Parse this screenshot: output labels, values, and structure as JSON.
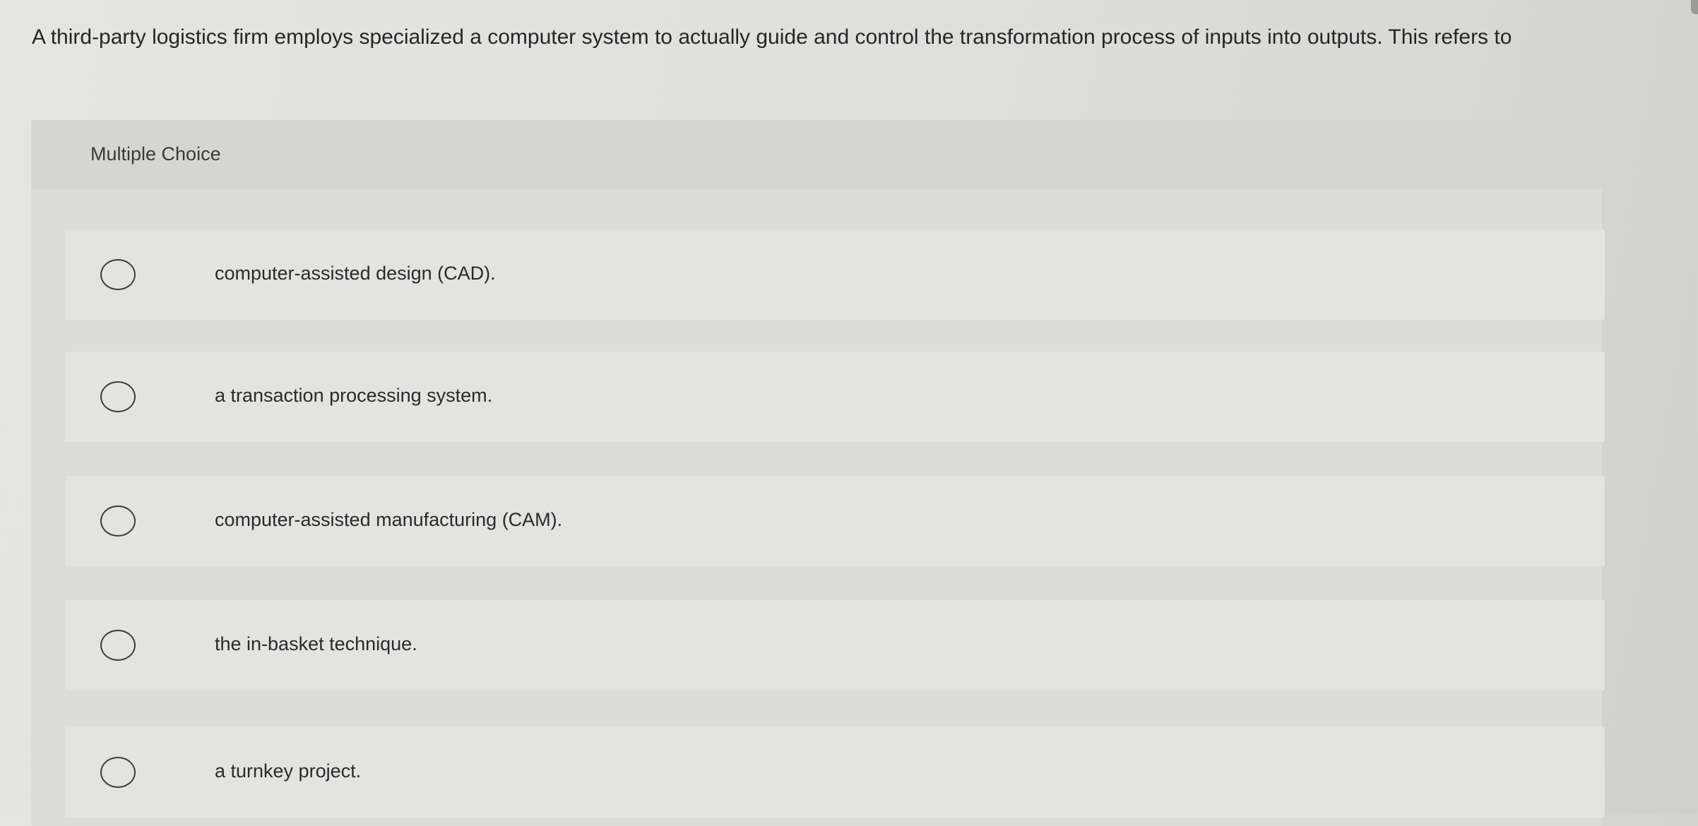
{
  "question": {
    "text": "A third-party logistics firm employs specialized a computer system to actually guide and control the transformation process of inputs into outputs. This refers to"
  },
  "multiple_choice": {
    "label": "Multiple Choice",
    "options": [
      {
        "text": "computer-assisted design (CAD)."
      },
      {
        "text": "a transaction processing system."
      },
      {
        "text": "computer-assisted manufacturing (CAM)."
      },
      {
        "text": "the in-basket technique."
      },
      {
        "text": "a turnkey project."
      }
    ]
  }
}
